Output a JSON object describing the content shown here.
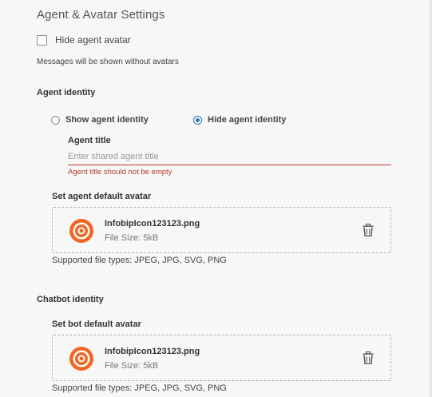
{
  "settings": {
    "title": "Agent & Avatar Settings",
    "hide_avatar": {
      "label": "Hide agent avatar",
      "checked": false,
      "hint": "Messages will be shown without avatars"
    },
    "agent_identity": {
      "title": "Agent identity",
      "options": [
        {
          "label": "Show agent identity",
          "selected": false
        },
        {
          "label": "Hide agent identity",
          "selected": true
        }
      ],
      "agent_title": {
        "label": "Agent title",
        "value": "",
        "placeholder": "Enter shared agent title",
        "error": "Agent title should not be empty"
      },
      "default_avatar": {
        "title": "Set agent default avatar",
        "file_name": "InfobipIcon123123.png",
        "file_size": "File Size: 5kB",
        "supported": "Supported file types: JPEG, JPG, SVG, PNG"
      }
    },
    "chatbot_identity": {
      "title": "Chatbot identity",
      "default_avatar": {
        "title": "Set bot default avatar",
        "file_name": "InfobipIcon123123.png",
        "file_size": "File Size: 5kB",
        "supported": "Supported file types: JPEG, JPG, SVG, PNG"
      }
    }
  },
  "colors": {
    "accent": "#2f6fb5",
    "error": "#c0392b",
    "logo": "#f26522"
  },
  "icons": {
    "file": "infobip-logo-icon",
    "delete": "trash-icon"
  }
}
